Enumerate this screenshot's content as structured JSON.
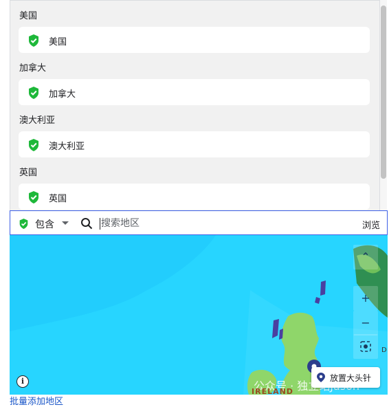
{
  "regions": [
    {
      "group_label": "美国",
      "item_label": "美国"
    },
    {
      "group_label": "加拿大",
      "item_label": "加拿大"
    },
    {
      "group_label": "澳大利亚",
      "item_label": "澳大利亚"
    },
    {
      "group_label": "英国",
      "item_label": "英国"
    }
  ],
  "search": {
    "mode_label": "包含",
    "placeholder": "搜索地区",
    "browse_label": "浏览"
  },
  "map": {
    "up_label": "⌃",
    "zoom_in_label": "+",
    "zoom_out_label": "−",
    "place_pin_label": "放置大头针",
    "info_label": "i",
    "place_label_ireland": "IRELAND",
    "edge_letter": "D",
    "watermark": "公众号 · 独立站Jason"
  },
  "bulk_add_label": "批量添加地区",
  "colors": {
    "shield_green": "#1eb83a",
    "accent_blue": "#3b5ee6",
    "land_green": "#8fd66a",
    "sea_cyan": "#27d5ff",
    "pin_navy": "#2c3e8c"
  }
}
